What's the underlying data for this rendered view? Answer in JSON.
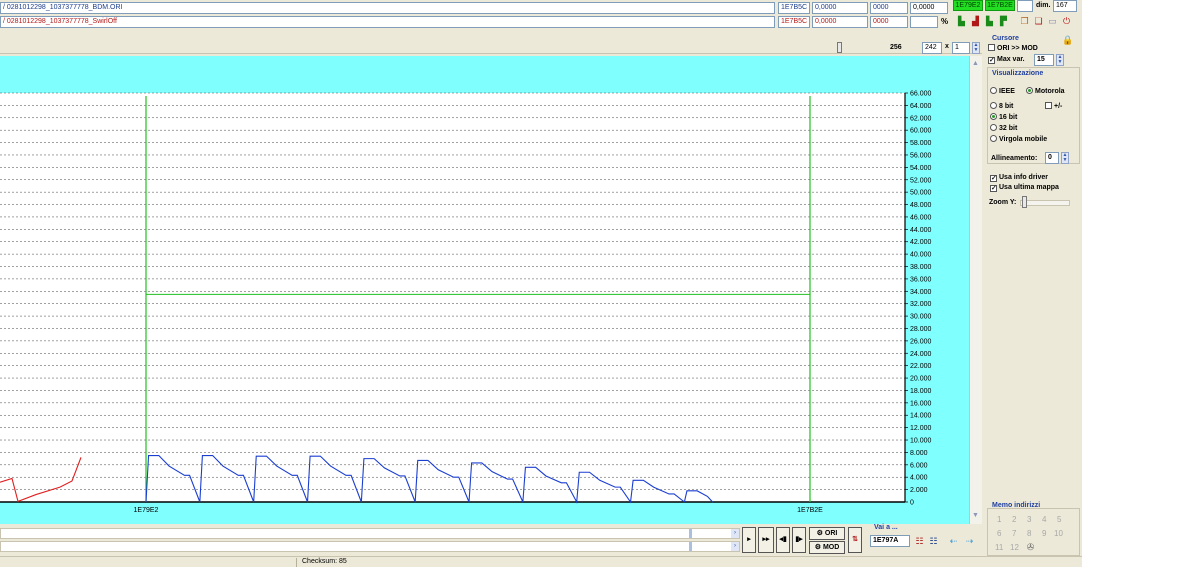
{
  "files": {
    "ori_name": "/ 0281012298_1037377778_BDM.ORI",
    "mod_name": "/ 0281012298_1037377778_SwirlOff",
    "ori_addr": "1E7B5C",
    "ori_val1": "0,0000",
    "ori_val2": "0000",
    "ori_val3": "0,0000",
    "mod_addr": "1E7B5C",
    "mod_val1": "0,0000",
    "mod_val2": "0000",
    "percent_symbol": "%"
  },
  "range": {
    "start": "1E79E2",
    "end": "1E7B2E",
    "dim_label": "dim.",
    "dim_value": "167"
  },
  "toolbar": {
    "width_value": "256",
    "count_value": "242",
    "multiplier_symbol": "x",
    "multiplier_value": "1"
  },
  "cursor_panel": {
    "title": "Cursore",
    "ori_mod_label": "ORI >> MOD",
    "max_var_label": "Max var.",
    "max_var_value": "15"
  },
  "view_panel": {
    "title": "Visualizzazione",
    "ieee_label": "IEEE",
    "motorola_label": "Motorola",
    "bit8_label": "8 bit",
    "sign_label": "+/-",
    "bit16_label": "16 bit",
    "bit32_label": "32 bit",
    "float_label": "Virgola mobile",
    "alignment_label": "Allineamento:",
    "alignment_value": "0",
    "use_driver_label": "Usa info driver",
    "use_last_map_label": "Usa ultima mappa",
    "zoom_label": "Zoom Y:"
  },
  "memo_panel": {
    "title": "Memo indirizzi",
    "slots": [
      "1",
      "2",
      "3",
      "4",
      "5",
      "6",
      "7",
      "8",
      "9",
      "10",
      "11",
      "12"
    ]
  },
  "navigation": {
    "ori_button": "ORI",
    "mod_button": "MOD",
    "goto_label": "Vai a ...",
    "goto_value": "1E797A"
  },
  "status": {
    "checksum": "Checksum: 85"
  },
  "colors": {
    "plot_bg": "#80ffff",
    "plot_area_bg": "#ffffff",
    "ori_line": "#e02020",
    "mod_line": "#1a3fd0",
    "marker": "#20c020",
    "highlight": "#22dd22"
  },
  "chart_data": {
    "type": "line",
    "ylim": [
      0,
      66000
    ],
    "y_ticks": [
      "0",
      "2.000",
      "4.000",
      "6.000",
      "8.000",
      "10.000",
      "12.000",
      "14.000",
      "16.000",
      "18.000",
      "20.000",
      "22.000",
      "24.000",
      "26.000",
      "28.000",
      "30.000",
      "32.000",
      "34.000",
      "36.000",
      "38.000",
      "40.000",
      "42.000",
      "44.000",
      "46.000",
      "48.000",
      "50.000",
      "52.000",
      "54.000",
      "56.000",
      "58.000",
      "60.000",
      "62.000",
      "64.000",
      "66.000"
    ],
    "x_markers": [
      "1E79E2",
      "1E7B2E"
    ],
    "grid": true,
    "cursor_level": 33500,
    "xlim": [
      0,
      260
    ],
    "series": [
      {
        "role": "ori",
        "x": [
          0,
          4,
          6,
          12,
          20,
          24,
          27
        ],
        "y": [
          3200,
          3800,
          100,
          1200,
          2400,
          3400,
          7200
        ]
      },
      {
        "role": "mod",
        "x": [
          49,
          50,
          54,
          58,
          64,
          66,
          70,
          71,
          75,
          79,
          85,
          87,
          91,
          92,
          96,
          100,
          106,
          108,
          112,
          113,
          117,
          121,
          127,
          129,
          133,
          134,
          138,
          142,
          148,
          150,
          154,
          155,
          159,
          163,
          169,
          171,
          175,
          176,
          180,
          184,
          190,
          192,
          196,
          197,
          201,
          205,
          211,
          213,
          217,
          218,
          222,
          226,
          232,
          234,
          238,
          239,
          243,
          247,
          253,
          255,
          259
        ],
        "y": [
          0,
          7500,
          7500,
          5800,
          4300,
          4300,
          0,
          7500,
          7500,
          5800,
          4300,
          4300,
          0,
          7400,
          7400,
          5800,
          4300,
          4300,
          0,
          7400,
          7400,
          5800,
          4300,
          4300,
          0,
          7000,
          7000,
          5500,
          4200,
          4200,
          0,
          6700,
          6700,
          5200,
          4000,
          4000,
          0,
          6300,
          6300,
          4900,
          3700,
          3700,
          0,
          5600,
          5600,
          4200,
          3100,
          3100,
          0,
          4800,
          4800,
          3500,
          2400,
          2400,
          0,
          3500,
          3500,
          2400,
          1300,
          1300,
          0
        ]
      },
      {
        "role": "mod",
        "x": [
          259,
          260,
          264,
          268,
          270
        ],
        "y": [
          0,
          1800,
          1800,
          900,
          0
        ]
      }
    ]
  }
}
